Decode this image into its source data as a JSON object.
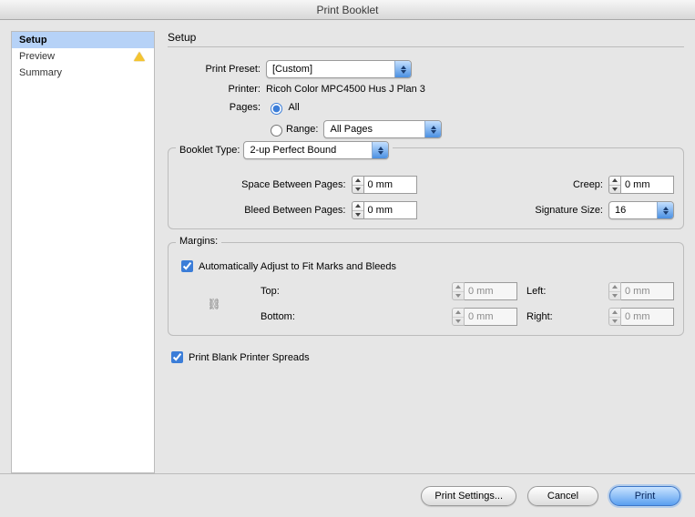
{
  "window": {
    "title": "Print Booklet"
  },
  "sidebar": {
    "items": [
      {
        "label": "Setup",
        "selected": true,
        "warning": false
      },
      {
        "label": "Preview",
        "selected": false,
        "warning": true
      },
      {
        "label": "Summary",
        "selected": false,
        "warning": false
      }
    ]
  },
  "main": {
    "title": "Setup",
    "preset_label": "Print Preset:",
    "preset_value": "[Custom]",
    "printer_label": "Printer:",
    "printer_value": "Ricoh Color MPC4500 Hus J Plan 3",
    "pages_label": "Pages:",
    "pages_all": "All",
    "pages_range": "Range:",
    "pages_range_value": "All Pages",
    "booklet": {
      "legend": "Booklet Type:",
      "type_value": "2-up Perfect Bound",
      "space_label": "Space Between Pages:",
      "space_value": "0 mm",
      "bleed_label": "Bleed Between Pages:",
      "bleed_value": "0 mm",
      "creep_label": "Creep:",
      "creep_value": "0 mm",
      "sig_label": "Signature Size:",
      "sig_value": "16"
    },
    "margins": {
      "legend": "Margins:",
      "auto_label": "Automatically Adjust to Fit Marks and Bleeds",
      "top_label": "Top:",
      "top_value": "0 mm",
      "bottom_label": "Bottom:",
      "bottom_value": "0 mm",
      "left_label": "Left:",
      "left_value": "0 mm",
      "right_label": "Right:",
      "right_value": "0 mm"
    },
    "print_blank_label": "Print Blank Printer Spreads"
  },
  "footer": {
    "settings": "Print Settings...",
    "cancel": "Cancel",
    "print": "Print"
  }
}
